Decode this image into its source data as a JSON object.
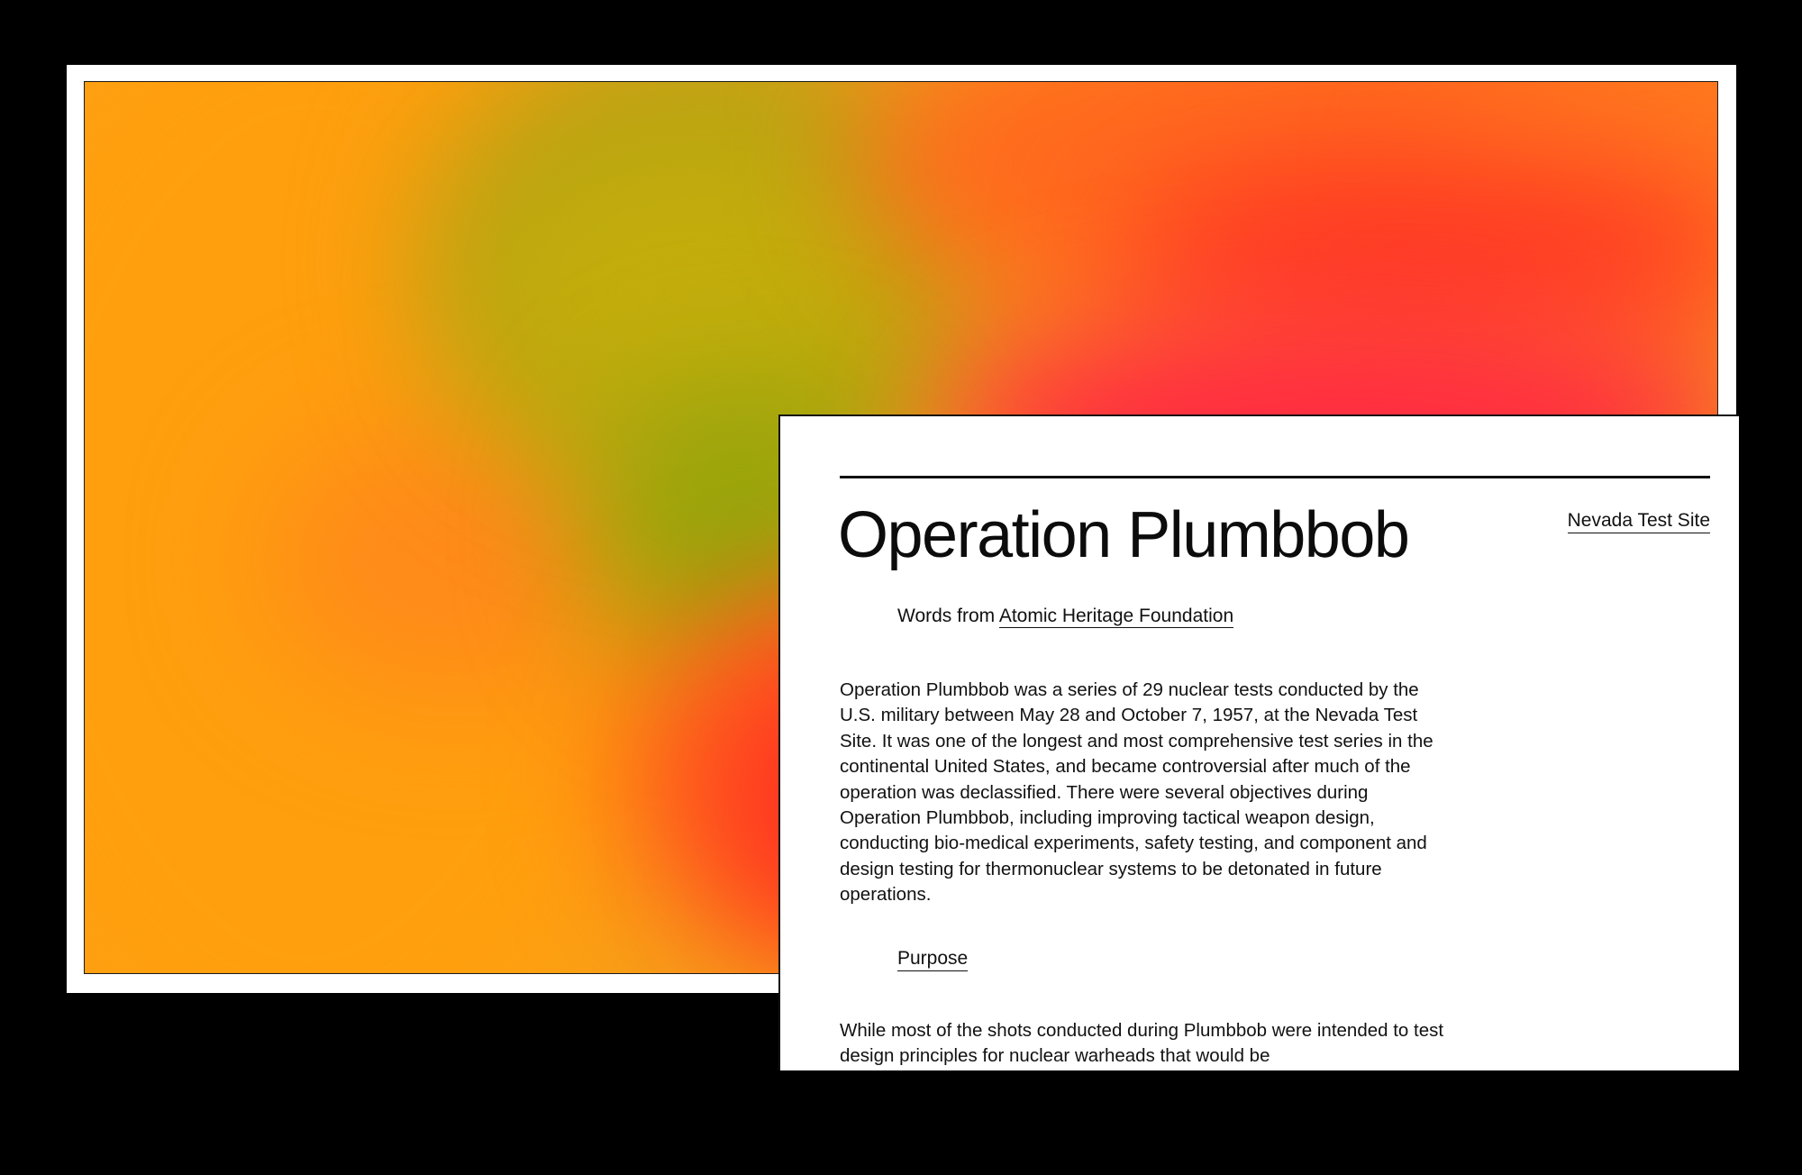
{
  "colors": {
    "background": "#000000",
    "panel": "#ffffff",
    "text": "#111111",
    "gradient_orange": "#ff9f0e",
    "gradient_olive": "#b6a215",
    "gradient_green": "#96a60b",
    "gradient_red": "#ff2a42"
  },
  "article": {
    "title": "Operation Plumbbob",
    "site_link": "Nevada Test Site",
    "source_prefix": "Words from ",
    "source_link": "Atomic Heritage Foundation",
    "paragraph_1": "Operation Plumbbob was a series of 29 nuclear tests conducted by the U.S. military between May 28 and October 7, 1957, at the Nevada Test Site. It was one of the longest and most comprehensive test series in the continental United States, and became controversial after much of the operation was declassified. There were several objectives during Operation Plumbbob, including improving tactical weapon design, conducting bio-medical experiments, safety testing, and component and design testing for thermonuclear systems to be detonated in future operations.",
    "section_link": "Purpose",
    "paragraph_2": "While most of the shots conducted during Plumbbob were intended to test design principles for nuclear warheads that would be"
  }
}
